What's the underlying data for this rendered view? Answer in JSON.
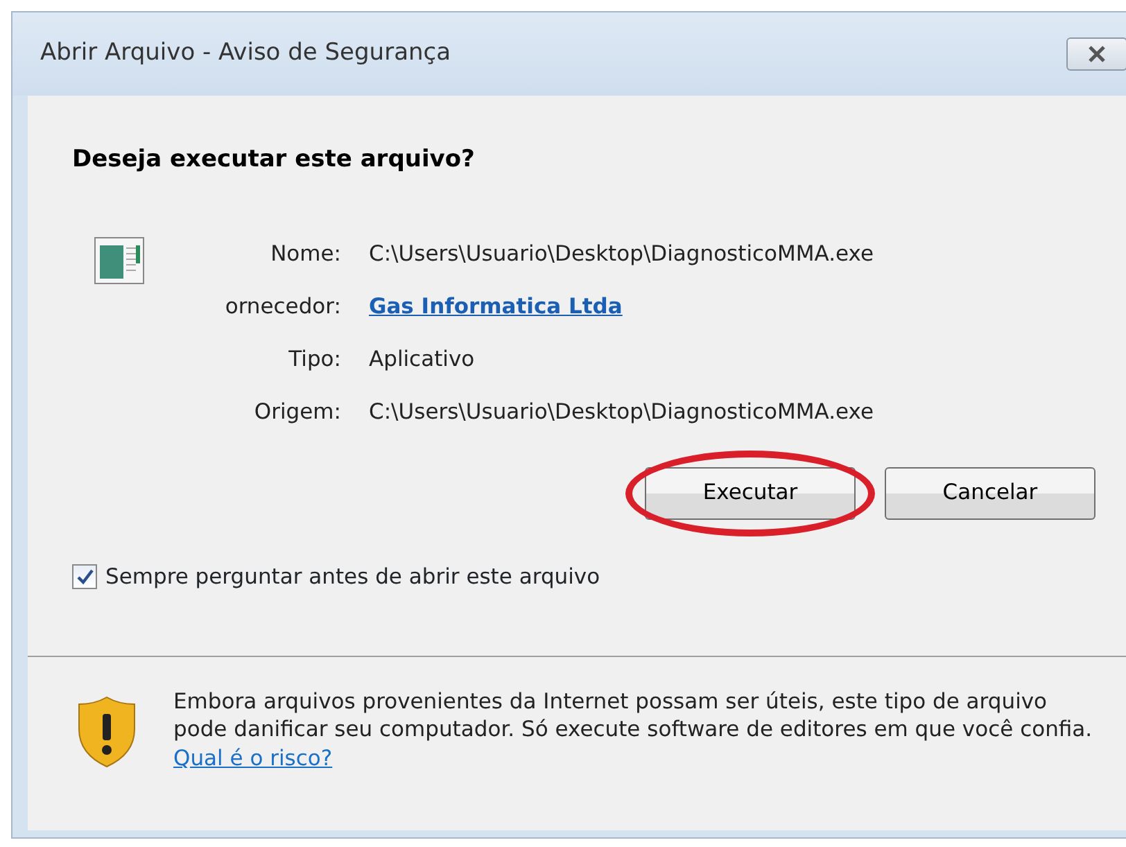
{
  "window": {
    "title": "Abrir Arquivo - Aviso de Segurança"
  },
  "heading": "Deseja executar este arquivo?",
  "fields": [
    {
      "label": "Nome:",
      "value": "C:\\Users\\Usuario\\Desktop\\DiagnosticoMMA.exe",
      "kind": "text"
    },
    {
      "label": "ornecedor:",
      "value": "Gas Informatica Ltda",
      "kind": "link"
    },
    {
      "label": "Tipo:",
      "value": "Aplicativo",
      "kind": "text"
    },
    {
      "label": "Origem:",
      "value": "C:\\Users\\Usuario\\Desktop\\DiagnosticoMMA.exe",
      "kind": "text"
    }
  ],
  "buttons": [
    {
      "label": "Executar",
      "highlighted": true
    },
    {
      "label": "Cancelar",
      "highlighted": false
    }
  ],
  "checkbox": {
    "label": "Sempre perguntar antes de abrir este arquivo",
    "checked": true
  },
  "warning": {
    "text": "Embora arquivos provenientes da Internet possam ser úteis, este tipo de arquivo pode danificar seu computador. Só execute software de editores em que você confia.",
    "link": "Qual é o risco?"
  }
}
